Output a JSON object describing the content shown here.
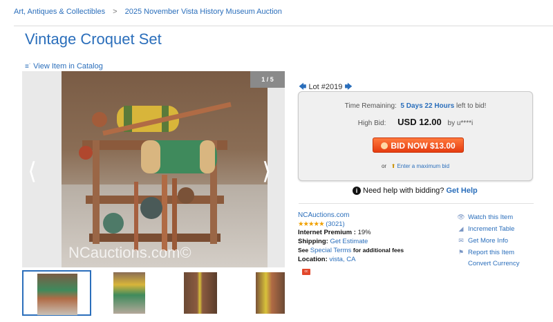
{
  "breadcrumb": [
    "Art, Antiques & Collectibles",
    "2025 November Vista History Museum Auction"
  ],
  "title": "Vintage Croquet Set",
  "view_catalog": "View Item in Catalog",
  "gallery": {
    "counter": "1 / 5",
    "watermark": "NCauctions.com©",
    "thumbnails": 4,
    "active_thumbnail": 1
  },
  "lot": "Lot #2019",
  "bid": {
    "time_label": "Time Remaining:",
    "time_value": "5 Days 22 Hours",
    "time_suffix": "left to bid!",
    "high_label": "High Bid:",
    "high_amount": "USD 12.00",
    "high_by": "by u****i",
    "button": "BID NOW $13.00",
    "max_prefix": "or",
    "max_link": "Enter a maximum bid"
  },
  "help": {
    "text": "Need help with bidding?",
    "link": "Get Help"
  },
  "seller": {
    "name": "NCAuctions.com",
    "stars": "★★★★★",
    "rating": "(3021)",
    "premium_label": "Internet Premium :",
    "premium_value": "19%",
    "shipping_label": "Shipping:",
    "shipping_link": "Get Estimate",
    "terms_pre": "See",
    "terms_link": "Special Terms",
    "terms_post": "for additional fees",
    "location_label": "Location:",
    "location_value": "vista, CA"
  },
  "actions": [
    "Watch this Item",
    "Increment Table",
    "Get More Info",
    "Report this Item",
    "Convert Currency"
  ],
  "icons": [
    "list-icon",
    "chevron-left-icon",
    "chevron-right-icon",
    "expand-icon",
    "arrow-left-icon",
    "arrow-right-icon",
    "bulb-icon",
    "info-icon",
    "eye-icon",
    "chart-icon",
    "mail-icon",
    "flag-icon"
  ],
  "colors": {
    "link": "#2a6ebb",
    "bid_button": "#e63c10",
    "stars": "#f0a000"
  }
}
